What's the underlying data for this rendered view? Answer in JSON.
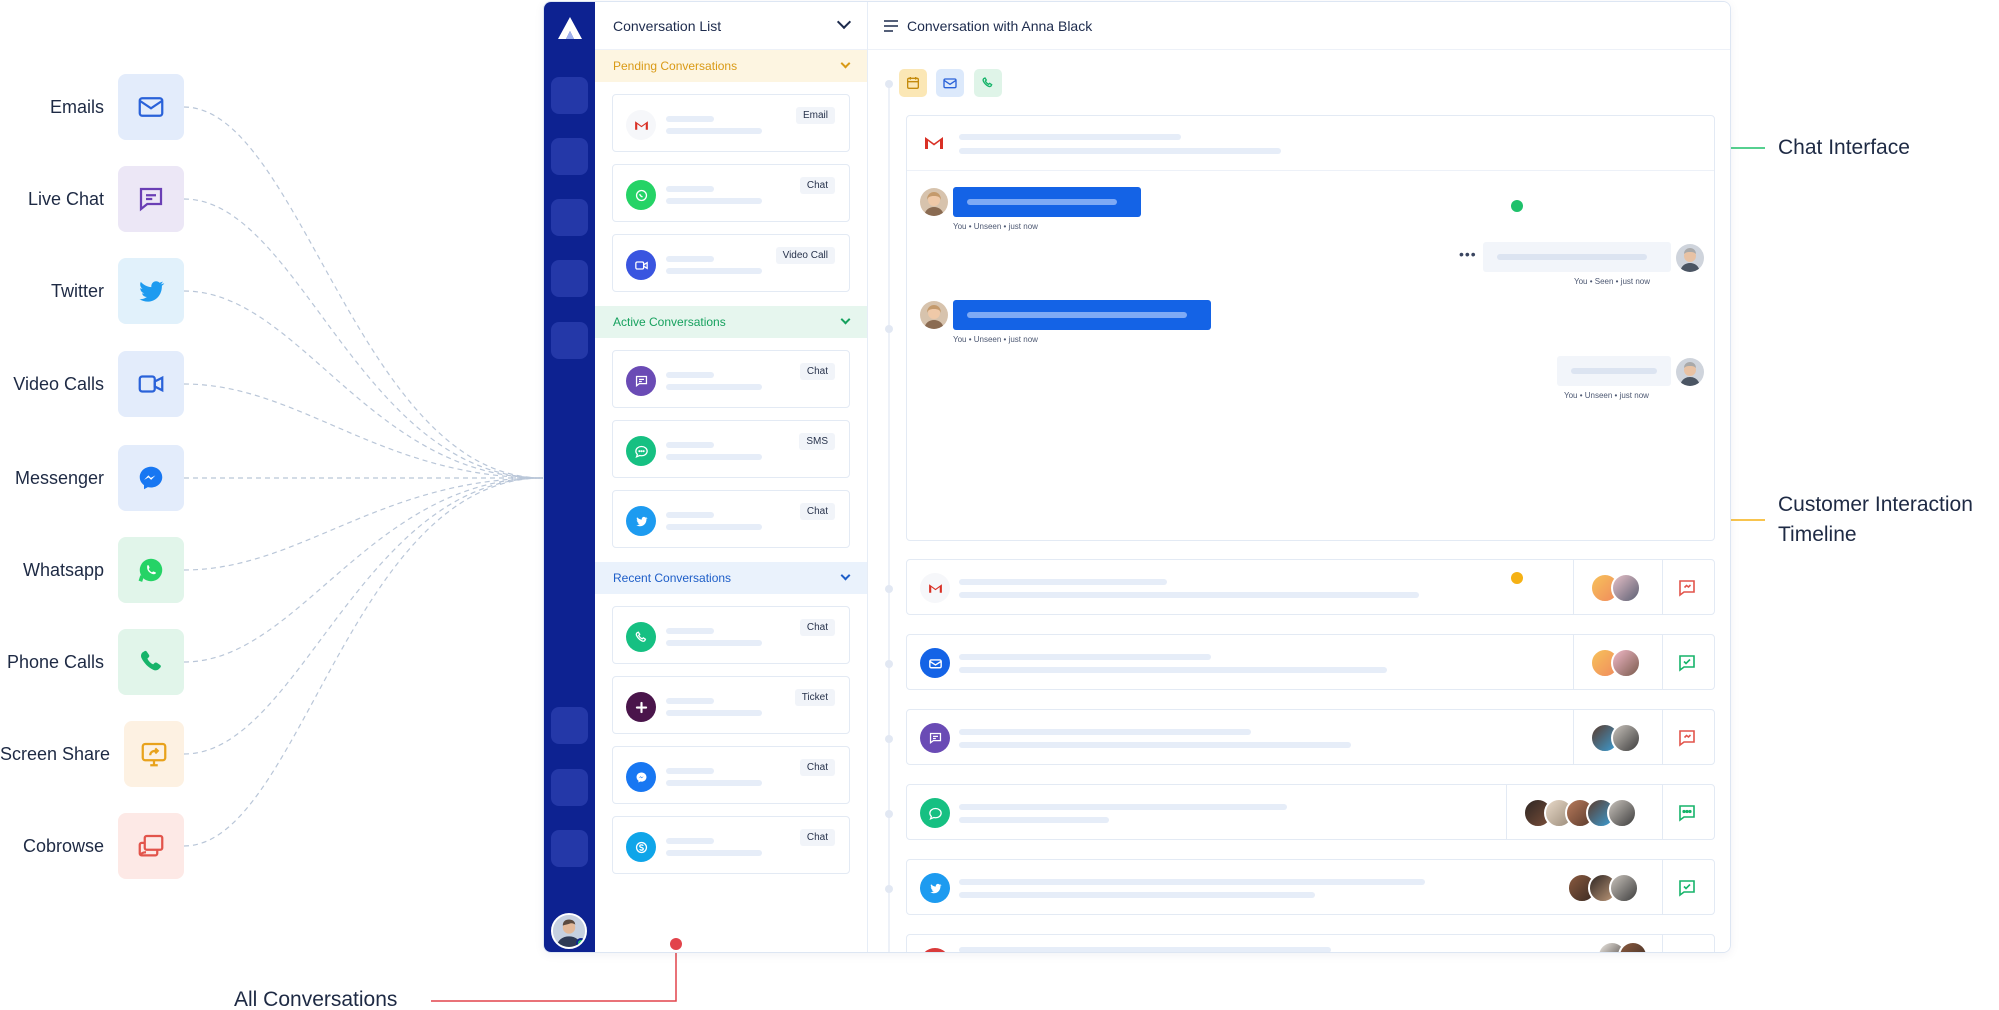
{
  "channels": [
    {
      "label": "Emails",
      "icon": "mail-icon",
      "bg": "#e3ecfb",
      "color": "#2a62d9"
    },
    {
      "label": "Live Chat",
      "icon": "chat-bubble-icon",
      "bg": "#ece7f6",
      "color": "#6a3fb5"
    },
    {
      "label": "Twitter",
      "icon": "twitter-icon",
      "bg": "#e1f1fb",
      "color": "#1d9bf0"
    },
    {
      "label": "Video Calls",
      "icon": "video-camera-icon",
      "bg": "#e3ecfb",
      "color": "#2a62d9"
    },
    {
      "label": "Messenger",
      "icon": "messenger-icon",
      "bg": "#e3ecfb",
      "color": "#1877f2"
    },
    {
      "label": "Whatsapp",
      "icon": "whatsapp-icon",
      "bg": "#e1f5ea",
      "color": "#25d366"
    },
    {
      "label": "Phone Calls",
      "icon": "phone-icon",
      "bg": "#e1f5ea",
      "color": "#16b46a"
    },
    {
      "label": "Screen Share",
      "icon": "screen-share-icon",
      "bg": "#fdf1e2",
      "color": "#e8a21c"
    },
    {
      "label": "Cobrowse",
      "icon": "cobrowse-icon",
      "bg": "#fde9e6",
      "color": "#e2544b"
    }
  ],
  "list": {
    "title": "Conversation List",
    "sections": [
      {
        "title": "Pending Conversations",
        "color": "#d99a16",
        "bg": "#fdf5e1",
        "items": [
          {
            "icon": "gmail-icon",
            "tag": "Email",
            "bg": "#f6f7fa"
          },
          {
            "icon": "whatsapp-icon",
            "tag": "Chat",
            "bg": "#25d366"
          },
          {
            "icon": "video-camera-icon",
            "tag": "Video Call",
            "bg": "#3a55e0"
          }
        ]
      },
      {
        "title": "Active Conversations",
        "color": "#16a15e",
        "bg": "#e6f6ee",
        "items": [
          {
            "icon": "chat-bubble-icon",
            "tag": "Chat",
            "bg": "#6a4bb5"
          },
          {
            "icon": "sms-icon",
            "tag": "SMS",
            "bg": "#16c082"
          },
          {
            "icon": "twitter-icon",
            "tag": "Chat",
            "bg": "#1d9bf0"
          }
        ]
      },
      {
        "title": "Recent Conversations",
        "color": "#1e5ec8",
        "bg": "#eaf2fc",
        "items": [
          {
            "icon": "phone-icon",
            "tag": "Chat",
            "bg": "#16c082"
          },
          {
            "icon": "slack-icon",
            "tag": "Ticket",
            "bg": "#4a154b"
          },
          {
            "icon": "messenger-icon",
            "tag": "Chat",
            "bg": "#1877f2"
          },
          {
            "icon": "skype-icon",
            "tag": "Chat",
            "bg": "#0fa5e9"
          }
        ]
      }
    ]
  },
  "conversation": {
    "title": "Conversation with Anna Black",
    "messages": [
      {
        "meta": "You •  Unseen •  just now"
      },
      {
        "meta": "You •  Seen •  just now"
      },
      {
        "meta": "You •  Unseen •  just now"
      },
      {
        "meta": "You •  Unseen •  just now"
      }
    ],
    "more_label": "•••",
    "timeline": [
      {
        "icon": "gmail-icon",
        "bg": "#f6f7fa",
        "action": "#e2544b"
      },
      {
        "icon": "mail-icon",
        "bg": "#1463e6",
        "action": "#16b46a"
      },
      {
        "icon": "chat-bubble-icon",
        "bg": "#6a4bb5",
        "action": "#e2544b"
      },
      {
        "icon": "sms-icon",
        "bg": "#16c082",
        "action": "#16b46a"
      },
      {
        "icon": "twitter-icon",
        "bg": "#1d9bf0",
        "action": "#16b46a"
      },
      {
        "icon": "ticket-icon",
        "bg": "#d93a3a",
        "action": "#e2544b"
      }
    ]
  },
  "annotations": {
    "chat_interface": "Chat Interface",
    "timeline_line1": "Customer Interaction",
    "timeline_line2": "Timeline",
    "all_conversations": "All Conversations"
  },
  "colors": {
    "rail": "#0d2291",
    "accent_blue": "#1463e6",
    "green_pin": "#1fc16b",
    "amber_pin": "#f5b114",
    "red_pin": "#e2444b"
  }
}
